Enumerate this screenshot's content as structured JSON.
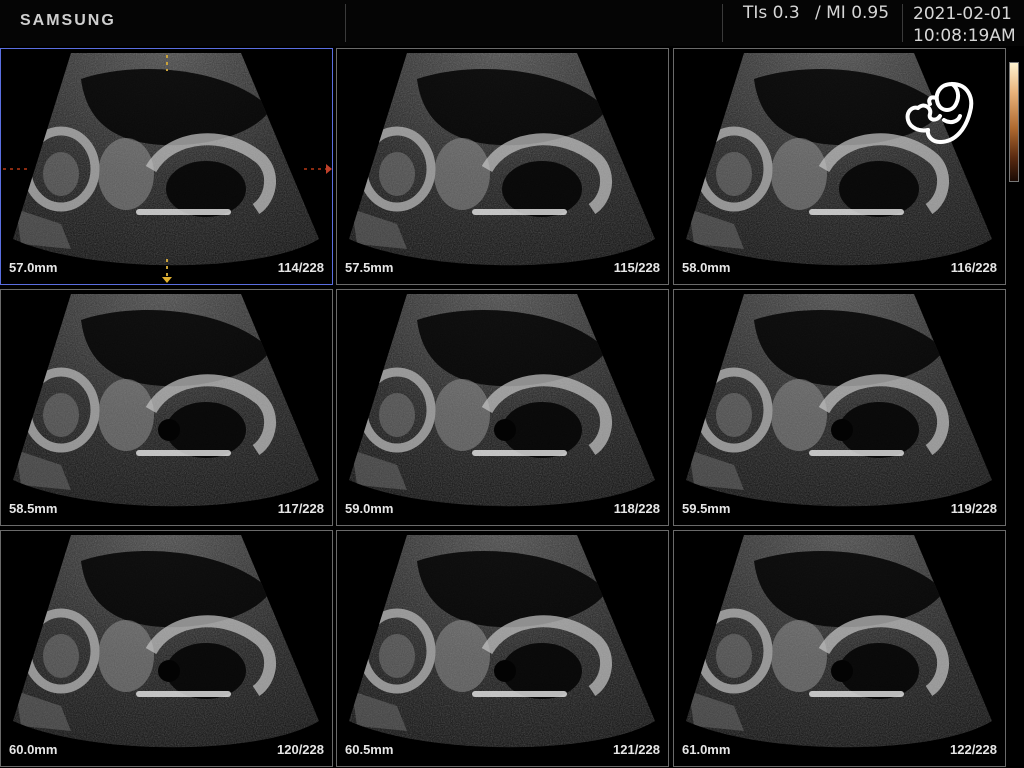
{
  "header": {
    "brand": "SAMSUNG",
    "tis": "TIs 0.3",
    "mi": "/ MI 0.95",
    "date": "2021-02-01",
    "time": "10:08:19AM"
  },
  "icons": {
    "fetus": "fetus-icon",
    "colorbar": "grayscale-map-bar"
  },
  "colors": {
    "active_border": "#5a6ee0",
    "panel_border": "#6a6a6a",
    "marker": "#c9a23a"
  },
  "panels": [
    {
      "depth": "57.0mm",
      "frame": "114/228",
      "active": true
    },
    {
      "depth": "57.5mm",
      "frame": "115/228",
      "active": false
    },
    {
      "depth": "58.0mm",
      "frame": "116/228",
      "active": false
    },
    {
      "depth": "58.5mm",
      "frame": "117/228",
      "active": false
    },
    {
      "depth": "59.0mm",
      "frame": "118/228",
      "active": false
    },
    {
      "depth": "59.5mm",
      "frame": "119/228",
      "active": false
    },
    {
      "depth": "60.0mm",
      "frame": "120/228",
      "active": false
    },
    {
      "depth": "60.5mm",
      "frame": "121/228",
      "active": false
    },
    {
      "depth": "61.0mm",
      "frame": "122/228",
      "active": false
    }
  ]
}
